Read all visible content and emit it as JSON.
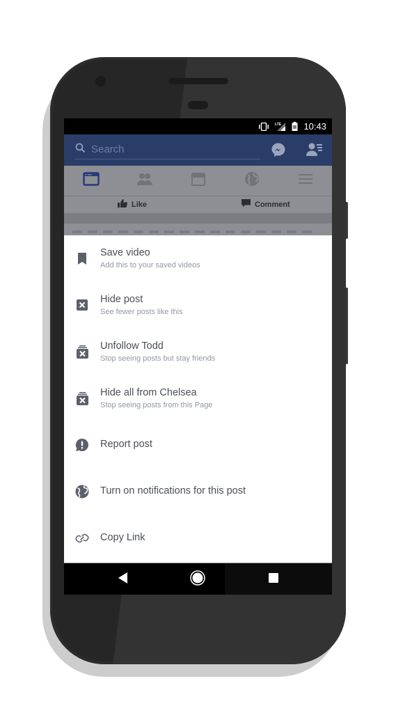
{
  "statusbar": {
    "time": "10:43",
    "icons": [
      "vibrate-icon",
      "lte-signal-icon",
      "battery-icon"
    ],
    "network_label": "LTE"
  },
  "appbar": {
    "search_placeholder": "Search",
    "icons": [
      "search-icon",
      "messenger-icon",
      "friend-requests-icon"
    ],
    "brand_color": "#2a3d69"
  },
  "nav_tabs": [
    {
      "name": "news-feed",
      "icon": "news-feed-icon",
      "active": true
    },
    {
      "name": "friends",
      "icon": "friends-icon",
      "active": false
    },
    {
      "name": "marketplace",
      "icon": "marketplace-icon",
      "active": false
    },
    {
      "name": "notifications",
      "icon": "globe-icon",
      "active": false
    },
    {
      "name": "menu",
      "icon": "menu-icon",
      "active": false
    }
  ],
  "post_actions": {
    "like_label": "Like",
    "comment_label": "Comment"
  },
  "menu": {
    "items": [
      {
        "icon": "bookmark-icon",
        "title": "Save video",
        "subtitle": "Add this to your saved videos"
      },
      {
        "icon": "hide-post-icon",
        "title": "Hide post",
        "subtitle": "See fewer posts like this"
      },
      {
        "icon": "unfollow-icon",
        "title": "Unfollow Todd",
        "subtitle": "Stop seeing posts but stay friends"
      },
      {
        "icon": "hide-all-icon",
        "title": "Hide all from Chelsea",
        "subtitle": "Stop seeing posts from this Page"
      },
      {
        "icon": "report-icon",
        "title": "Report post"
      },
      {
        "icon": "globe-icon",
        "title": "Turn on notifications for this post"
      },
      {
        "icon": "link-icon",
        "title": "Copy Link"
      }
    ]
  },
  "system_nav": {
    "buttons": [
      "back",
      "home",
      "recents"
    ]
  }
}
